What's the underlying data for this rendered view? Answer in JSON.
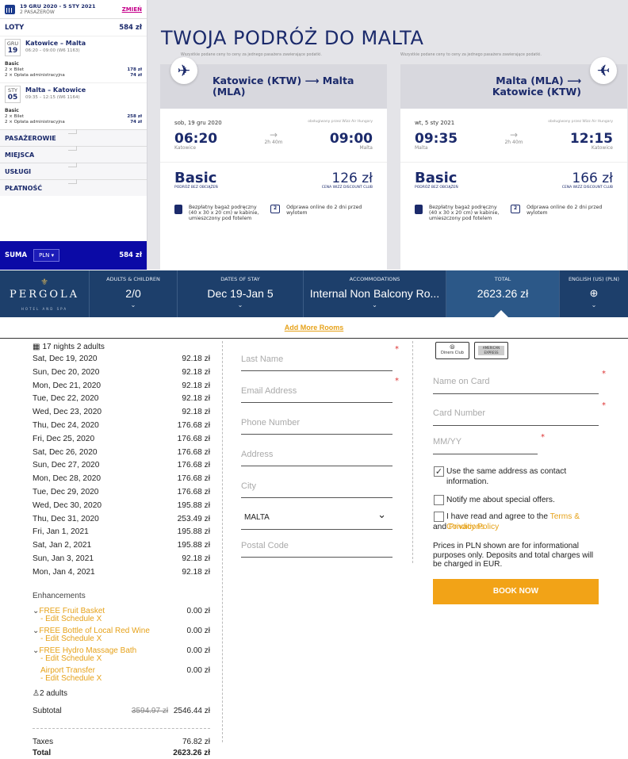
{
  "wizz": {
    "dates": "19 GRU 2020 - 5 STY 2021",
    "passengers": "2 PASAŻERÓW",
    "change": "ZMIEŃ",
    "flights_label": "LOTY",
    "flights_total": "584 zł",
    "outbound": {
      "mon": "GRU",
      "day": "19",
      "route": "Katowice – Malta",
      "details": "06:20 – 09:00 (W6 1163)",
      "fare": "Basic",
      "r1": "2 × Bilet",
      "r1v": "178 zł",
      "r2": "2 × Opłata administracyjna",
      "r2v": "74 zł"
    },
    "inbound": {
      "mon": "STY",
      "day": "05",
      "route": "Malta – Katowice",
      "details": "09:35 – 12:15 (W6 1164)",
      "fare": "Basic",
      "r1": "2 × Bilet",
      "r1v": "258 zł",
      "r2": "2 × Opłata administracyjna",
      "r2v": "74 zł"
    },
    "sections": [
      "PASAŻEROWIE",
      "MIEJSCA",
      "USŁUGI",
      "PŁATNOŚĆ"
    ],
    "suma": "SUMA",
    "currency": "PLN",
    "suma_total": "584 zł",
    "title": "TWOJA PODRÓŻ DO MALTA",
    "note": "Wszystkie podane ceny to ceny za jednego pasażera zawierające podatki.",
    "card1": {
      "route": "Katowice (KTW) ⟶ Malta (MLA)",
      "date": "sob, 19 gru 2020",
      "operated": "obsługiwany przez Wizz Air Hungary",
      "dep": "06:20",
      "arr": "09:00",
      "dur": "2h 40m",
      "from": "Katowice",
      "to": "Malta",
      "fare": "Basic",
      "fare_sub": "PODRÓŻ BEZ OBCIĄŻEŃ",
      "price": "126 zł",
      "price_sub": "CENA WIZZ DISCOUNT CLUB"
    },
    "card2": {
      "route": "Malta (MLA) ⟶ Katowice (KTW)",
      "date": "wt, 5 sty 2021",
      "operated": "obsługiwany przez Wizz Air Hungary",
      "dep": "09:35",
      "arr": "12:15",
      "dur": "2h 40m",
      "from": "Malta",
      "to": "Katowice",
      "fare": "Basic",
      "fare_sub": "PODRÓŻ BEZ OBCIĄŻEŃ",
      "price": "166 zł",
      "price_sub": "CENA WIZZ DISCOUNT CLUB"
    },
    "feat_bag": "Bezpłatny bagaż podręczny (40 x 30 x 20 cm) w kabinie, umieszczony pod fotelem",
    "feat_checkin": "Odprawa online do 2 dni przed wylotem"
  },
  "pergola": {
    "logo": "PERGOLA",
    "logo_sub": "HOTEL AND SPA",
    "hdr": [
      {
        "label": "ADULTS & CHILDREN",
        "value": "2/0"
      },
      {
        "label": "DATES OF STAY",
        "value": "Dec 19-Jan 5"
      },
      {
        "label": "ACCOMMODATIONS",
        "value": "Internal Non Balcony Ro..."
      },
      {
        "label": "TOTAL",
        "value": "2623.26 zł"
      },
      {
        "label": "ENGLISH (US) (PLN)",
        "value": "⊕"
      }
    ],
    "add_rooms": "Add More Rooms",
    "summary": "17 nights  2 adults",
    "nights": [
      [
        "Sat, Dec 19, 2020",
        "92.18 zł"
      ],
      [
        "Sun, Dec 20, 2020",
        "92.18 zł"
      ],
      [
        "Mon, Dec 21, 2020",
        "92.18 zł"
      ],
      [
        "Tue, Dec 22, 2020",
        "92.18 zł"
      ],
      [
        "Wed, Dec 23, 2020",
        "92.18 zł"
      ],
      [
        "Thu, Dec 24, 2020",
        "176.68 zł"
      ],
      [
        "Fri, Dec 25, 2020",
        "176.68 zł"
      ],
      [
        "Sat, Dec 26, 2020",
        "176.68 zł"
      ],
      [
        "Sun, Dec 27, 2020",
        "176.68 zł"
      ],
      [
        "Mon, Dec 28, 2020",
        "176.68 zł"
      ],
      [
        "Tue, Dec 29, 2020",
        "176.68 zł"
      ],
      [
        "Wed, Dec 30, 2020",
        "195.88 zł"
      ],
      [
        "Thu, Dec 31, 2020",
        "253.49 zł"
      ],
      [
        "Fri, Jan 1, 2021",
        "195.88 zł"
      ],
      [
        "Sat, Jan 2, 2021",
        "195.88 zł"
      ],
      [
        "Sun, Jan 3, 2021",
        "92.18 zł"
      ],
      [
        "Mon, Jan 4, 2021",
        "92.18 zł"
      ]
    ],
    "enhancements_label": "Enhancements",
    "enhancements": [
      {
        "name": "FREE Fruit Basket",
        "edit": "- Edit Schedule X",
        "price": "0.00 zł",
        "chev": true
      },
      {
        "name": "FREE Bottle of Local Red Wine",
        "edit": "- Edit Schedule X",
        "price": "0.00 zł",
        "chev": true
      },
      {
        "name": "FREE Hydro Massage Bath",
        "edit": "- Edit Schedule X",
        "price": "0.00 zł",
        "chev": true
      },
      {
        "name": "Airport Transfer",
        "edit": "- Edit Schedule X",
        "price": "0.00 zł",
        "chev": false
      }
    ],
    "adults": "2 adults",
    "subtotal_label": "Subtotal",
    "subtotal_old": "3594.97 zł",
    "subtotal": "2546.44 zł",
    "taxes_label": "Taxes",
    "taxes": "76.82 zł",
    "total_label": "Total",
    "total": "2623.26 zł",
    "form": {
      "last_name": "Last Name",
      "email": "Email Address",
      "phone": "Phone Number",
      "address": "Address",
      "city": "City",
      "country": "MALTA",
      "postal": "Postal Code"
    },
    "cards": [
      "Diners Club",
      "AMERICAN EXPRESS"
    ],
    "pay": {
      "name": "Name on Card",
      "number": "Card Number",
      "exp": "MM/YY"
    },
    "same_address": "Use the same address as contact information.",
    "notify": "Notify me about special offers.",
    "agree_pre": "I have read and agree to the ",
    "terms": "Terms & Conditions",
    "and": " and ",
    "privacy": "Privacy Policy",
    "prices_note": "Prices in PLN shown are for informational purposes only. Deposits and total charges will be charged in EUR.",
    "book": "BOOK NOW"
  }
}
